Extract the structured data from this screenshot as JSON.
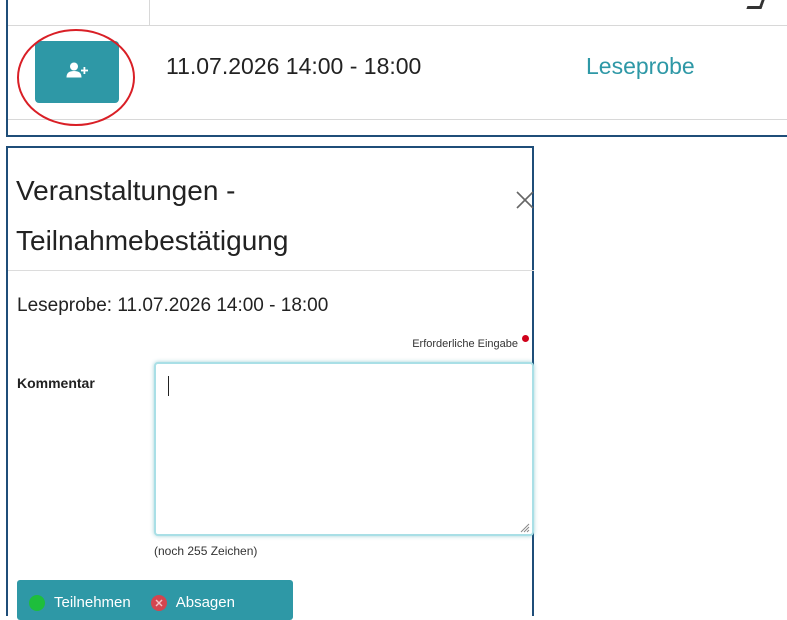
{
  "event_row": {
    "add_button_icon": "user-plus-icon",
    "date_time": "11.07.2026 14:00 - 18:00",
    "event_type": "Leseprobe"
  },
  "dialog": {
    "title_line1": "Veranstaltungen -",
    "title_line2": "Teilnahmebestätigung",
    "close_icon": "close-icon",
    "subtitle": "Leseprobe: 11.07.2026 14:00 - 18:00",
    "required_hint": "Erforderliche Eingabe",
    "comment_label": "Kommentar",
    "comment_value": "",
    "remaining_chars": "(noch 255 Zeichen)",
    "actions": {
      "accept_label": "Teilnehmen",
      "decline_label": "Absagen"
    }
  },
  "colors": {
    "accent": "#2e98a6",
    "frame": "#1f4e79",
    "highlight": "#d91f26",
    "required": "#d0021b",
    "accept": "#1ebe3c",
    "decline": "#d3454f"
  }
}
